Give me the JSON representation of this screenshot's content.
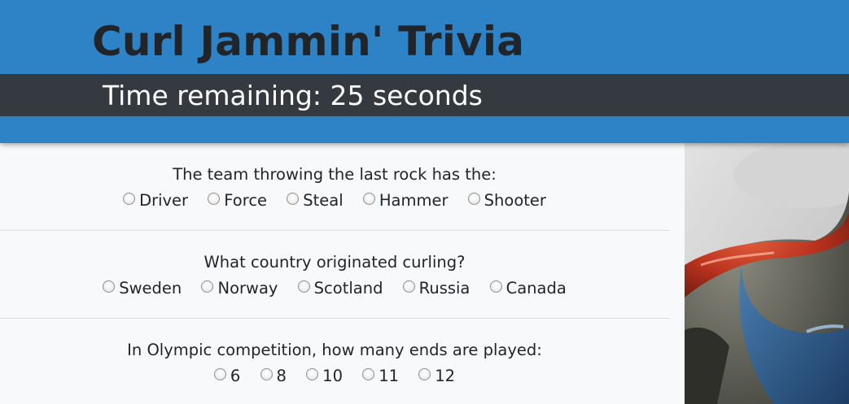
{
  "header": {
    "title": "Curl Jammin' Trivia",
    "timer_text": "Time remaining: 25 seconds"
  },
  "questions": [
    {
      "text": "The team throwing the last rock has the:",
      "options": [
        "Driver",
        "Force",
        "Steal",
        "Hammer",
        "Shooter"
      ]
    },
    {
      "text": "What country originated curling?",
      "options": [
        "Sweden",
        "Norway",
        "Scotland",
        "Russia",
        "Canada"
      ]
    },
    {
      "text": "In Olympic competition, how many ends are played:",
      "options": [
        "6",
        "8",
        "10",
        "11",
        "12"
      ]
    }
  ],
  "photo": {
    "icon": "curling-stone-image"
  },
  "colors": {
    "header_bg": "#2e82c6",
    "timer_bg": "#343a40",
    "page_bg": "#f8f9fa"
  }
}
